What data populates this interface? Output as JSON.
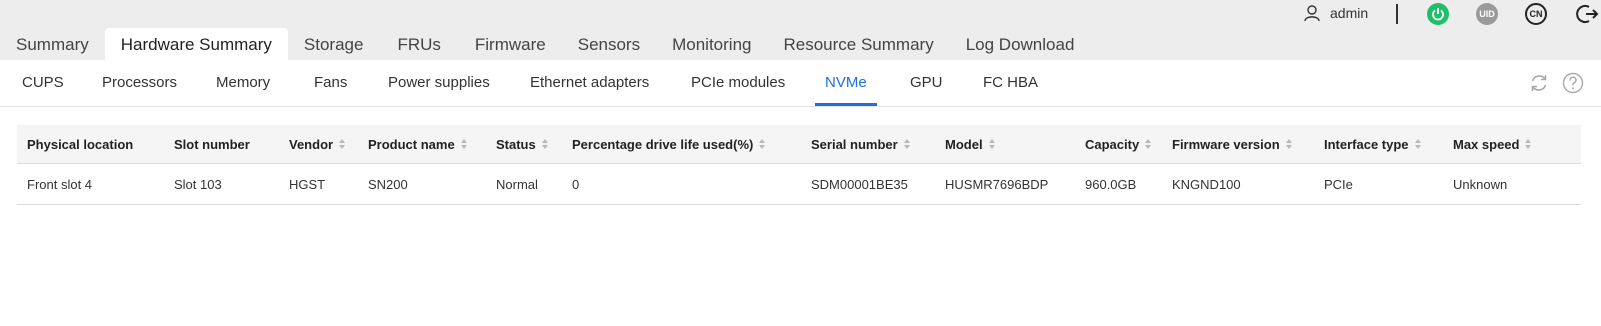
{
  "header": {
    "username": "admin",
    "uid_label": "UID",
    "lang_label": "CN"
  },
  "main_tabs": [
    {
      "label": "Summary"
    },
    {
      "label": "Hardware Summary"
    },
    {
      "label": "Storage"
    },
    {
      "label": "FRUs"
    },
    {
      "label": "Firmware"
    },
    {
      "label": "Sensors"
    },
    {
      "label": "Monitoring"
    },
    {
      "label": "Resource Summary"
    },
    {
      "label": "Log Download"
    }
  ],
  "sub_tabs": [
    {
      "label": "CUPS"
    },
    {
      "label": "Processors"
    },
    {
      "label": "Memory"
    },
    {
      "label": "Fans"
    },
    {
      "label": "Power supplies"
    },
    {
      "label": "Ethernet adapters"
    },
    {
      "label": "PCIe modules"
    },
    {
      "label": "NVMe"
    },
    {
      "label": "GPU"
    },
    {
      "label": "FC HBA"
    }
  ],
  "table": {
    "columns": [
      {
        "label": "Physical location"
      },
      {
        "label": "Slot number"
      },
      {
        "label": "Vendor"
      },
      {
        "label": "Product name"
      },
      {
        "label": "Status"
      },
      {
        "label": "Percentage drive life used(%)"
      },
      {
        "label": "Serial number"
      },
      {
        "label": "Model"
      },
      {
        "label": "Capacity"
      },
      {
        "label": "Firmware version"
      },
      {
        "label": "Interface type"
      },
      {
        "label": "Max speed"
      }
    ],
    "rows": [
      [
        "Front slot 4",
        "Slot 103",
        "HGST",
        "SN200",
        "Normal",
        "0",
        "SDM00001BE35",
        "HUSMR7696BDP",
        "960.0GB",
        "KNGND100",
        "PCIe",
        "Unknown"
      ]
    ]
  }
}
